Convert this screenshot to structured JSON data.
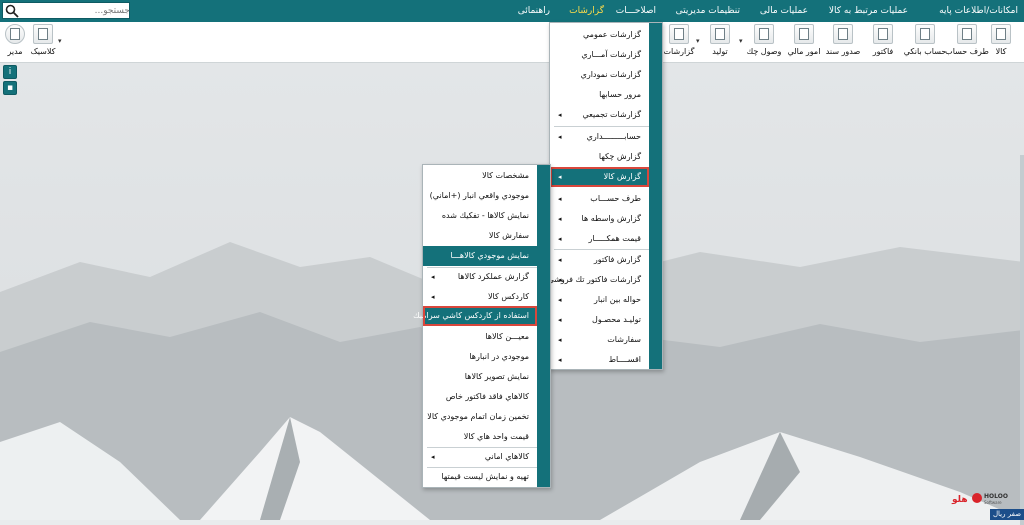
{
  "menubar": {
    "items": [
      {
        "label": "امکانات/اطلاعات پایه",
        "active": false
      },
      {
        "label": "عملیات مرتبط به کالا",
        "active": false
      },
      {
        "label": "عملیات مالی",
        "active": false
      },
      {
        "label": "تنظیمات مدیریتی",
        "active": false
      },
      {
        "label": "اصلاحـــات",
        "active": false
      },
      {
        "label": "گزارشات",
        "active": true
      },
      {
        "label": "راهنمائی",
        "active": false
      }
    ]
  },
  "search": {
    "placeholder": "جستجو..."
  },
  "toolbar": {
    "buttons": [
      {
        "label": "کالا",
        "icon": "box-icon"
      },
      {
        "label": "طرف حساب",
        "icon": "person-icon"
      },
      {
        "label": "حساب بانکي",
        "icon": "bank-icon"
      },
      {
        "label": "فاکتور",
        "icon": "invoice-icon"
      },
      {
        "label": "صدور سند",
        "icon": "document-icon"
      },
      {
        "label": "امور مالي",
        "icon": "finance-icon"
      },
      {
        "label": "وصول چك",
        "icon": "cheque-icon"
      },
      {
        "label": "توليد",
        "icon": "production-icon"
      },
      {
        "label": "گزارشات",
        "icon": "reports-icon"
      },
      {
        "label": "كلاسيک",
        "icon": "classic-icon"
      },
      {
        "label": "مدیر",
        "icon": "manager-icon"
      }
    ]
  },
  "reports_menu": {
    "items": [
      {
        "label": "گزارشات عمومي",
        "arrow": false
      },
      {
        "label": "گزارشات آمـــاري",
        "arrow": false
      },
      {
        "label": "گزارشات نموداري",
        "arrow": false
      },
      {
        "label": "مرور حسابها",
        "arrow": false
      },
      {
        "label": "گزارشات تجمیعي",
        "arrow": true
      },
      {
        "label": "حسابـــــــــداري",
        "arrow": true
      },
      {
        "label": "گزارش چکها",
        "arrow": false
      },
      {
        "label": "گزارش کالا",
        "arrow": true
      },
      {
        "label": "طرف حســـاب",
        "arrow": true
      },
      {
        "label": "گزارش واسطه ها",
        "arrow": true
      },
      {
        "label": "قیمت همکـــــار",
        "arrow": true
      },
      {
        "label": "گزارش فاکتور",
        "arrow": true
      },
      {
        "label": "گزارشات فاکتور تك فروشي",
        "arrow": true
      },
      {
        "label": "حواله بین انبار",
        "arrow": true
      },
      {
        "label": "تولیـد محصـول",
        "arrow": true
      },
      {
        "label": "سفارشات",
        "arrow": true
      },
      {
        "label": "اقســــاط",
        "arrow": true
      }
    ]
  },
  "goods_submenu": {
    "items": [
      {
        "label": "مشخصات کالا",
        "arrow": false
      },
      {
        "label": "موجودي واقعي انبار (+اماني)",
        "arrow": false
      },
      {
        "label": "نمایش کالاها - تفکیك شده",
        "arrow": false
      },
      {
        "label": "سفارش کالا",
        "arrow": false
      },
      {
        "label": "نمایش موجودي کالاهـــا",
        "arrow": false
      },
      {
        "label": "گزارش عملکرد کالاها",
        "arrow": true
      },
      {
        "label": "کاردکس کالا",
        "arrow": true
      },
      {
        "label": "استفاده از کاردکس کاشي سرامیك",
        "arrow": false
      },
      {
        "label": "معیـــن کالاها",
        "arrow": false
      },
      {
        "label": "موجودي در انبارها",
        "arrow": false
      },
      {
        "label": "نمایش تصویر کالاها",
        "arrow": false
      },
      {
        "label": "کالاهاي فاقد فاکتور خاص",
        "arrow": false
      },
      {
        "label": "تخمین زمان اتمام موجودي کالا",
        "arrow": false
      },
      {
        "label": "قیمت واحد هاي کالا",
        "arrow": false
      },
      {
        "label": "کالاهاي اماني",
        "arrow": true
      },
      {
        "label": "تهیه و نمایش لیست قیمتها",
        "arrow": false
      }
    ]
  },
  "branding": {
    "logo_text": "هلو",
    "logo_sub": "HOLOO Software"
  },
  "status": {
    "label": "صفر ریال"
  },
  "colors": {
    "accent": "#14717a",
    "highlight_box": "#d9473c",
    "active_menu": "#ffdd4a"
  }
}
